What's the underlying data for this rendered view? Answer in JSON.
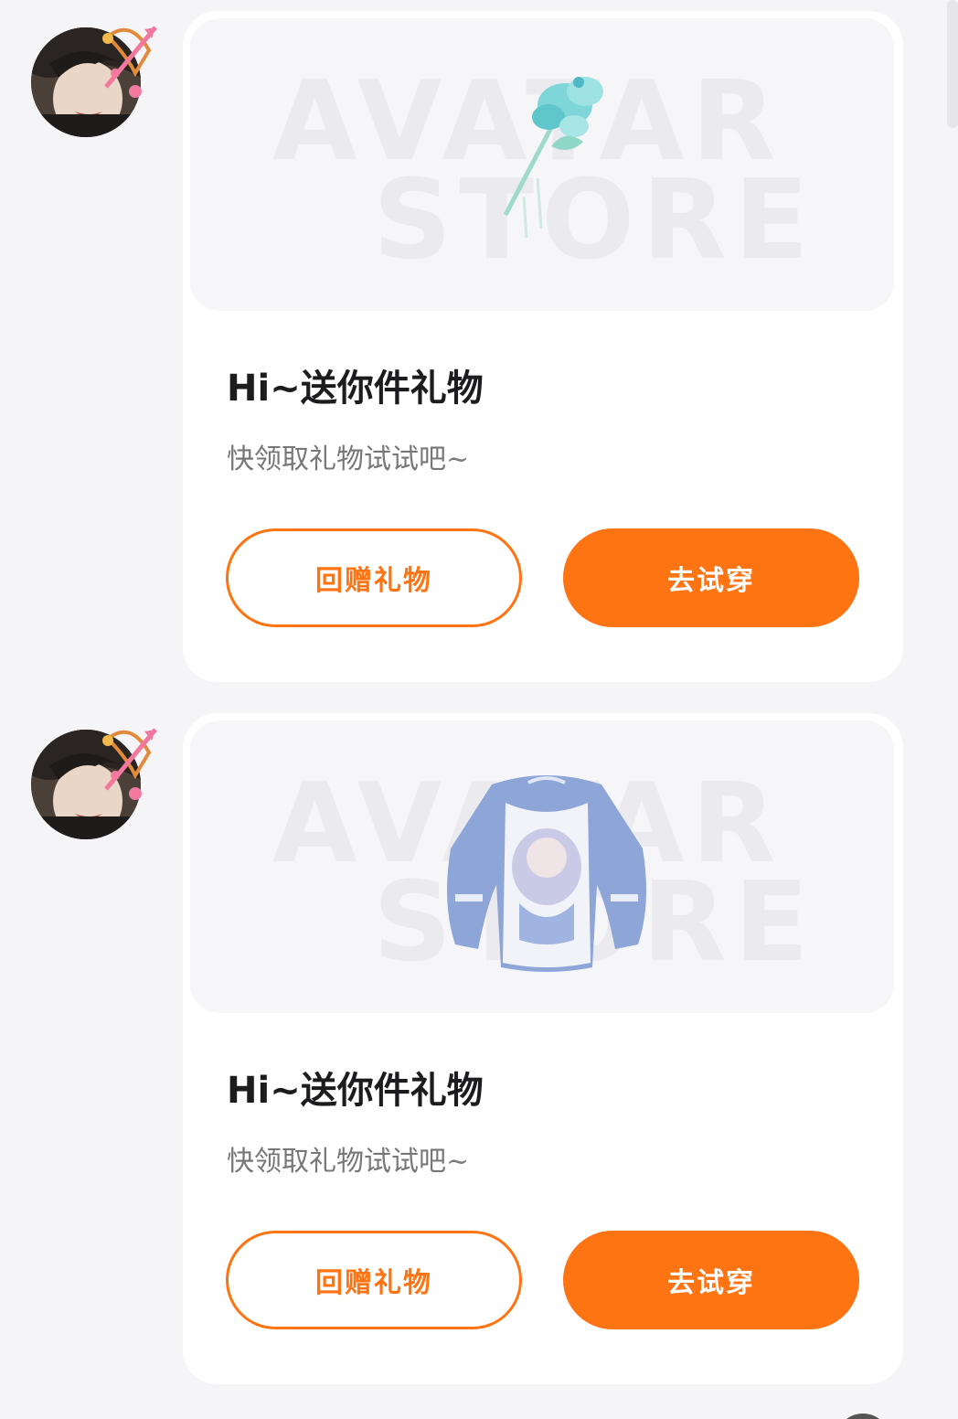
{
  "colors": {
    "accent": "#fe7413",
    "background": "#f5f5f7",
    "card": "#ffffff",
    "title": "#1c1c1e",
    "subtitle": "#777778"
  },
  "messages": [
    {
      "item": "flower-hairpin",
      "title": "Hi~送你件礼物",
      "subtitle": "快领取礼物试试吧~",
      "return_gift_label": "回赠礼物",
      "try_on_label": "去试穿"
    },
    {
      "item": "blue-sweatshirt",
      "title": "Hi~送你件礼物",
      "subtitle": "快领取礼物试试吧~",
      "return_gift_label": "回赠礼物",
      "try_on_label": "去试穿"
    }
  ],
  "watermark": {
    "line1": "AVATAR",
    "line2": "STORE"
  }
}
